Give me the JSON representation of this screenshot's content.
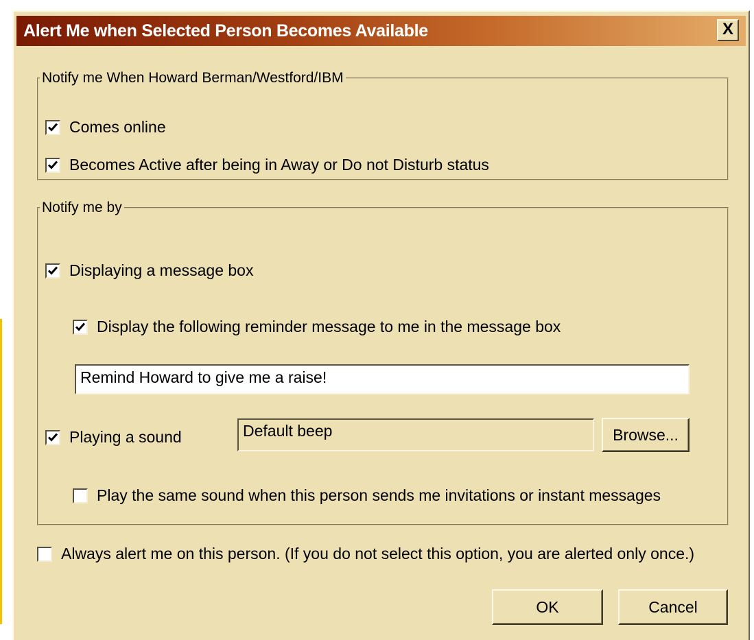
{
  "dialog": {
    "title": "Alert Me when Selected Person Becomes Available",
    "close_label": "X"
  },
  "notify_when": {
    "legend": "Notify me When Howard Berman/Westford/IBM",
    "options": [
      {
        "label": "Comes online",
        "checked": true
      },
      {
        "label": "Becomes Active after being in Away or Do not Disturb status",
        "checked": true
      }
    ]
  },
  "notify_by": {
    "legend": "Notify me by",
    "message_box": {
      "label": "Displaying a message box",
      "checked": true
    },
    "reminder": {
      "label": "Display the following reminder message to me in the message box",
      "checked": true
    },
    "reminder_text": "Remind Howard to give me a raise!",
    "sound": {
      "label": "Playing a sound",
      "checked": true
    },
    "sound_file": "Default beep",
    "browse_label": "Browse...",
    "same_sound": {
      "label": "Play the same sound when this person sends me invitations or instant messages",
      "checked": false
    }
  },
  "always_alert": {
    "label": "Always alert me on this person. (If you do not select this option, you are alerted only once.)",
    "checked": false
  },
  "buttons": {
    "ok": "OK",
    "cancel": "Cancel"
  },
  "colors": {
    "dialog_background": "#ede0b3",
    "titlebar_start": "#7a1a04",
    "titlebar_end": "#e5ad6a"
  }
}
